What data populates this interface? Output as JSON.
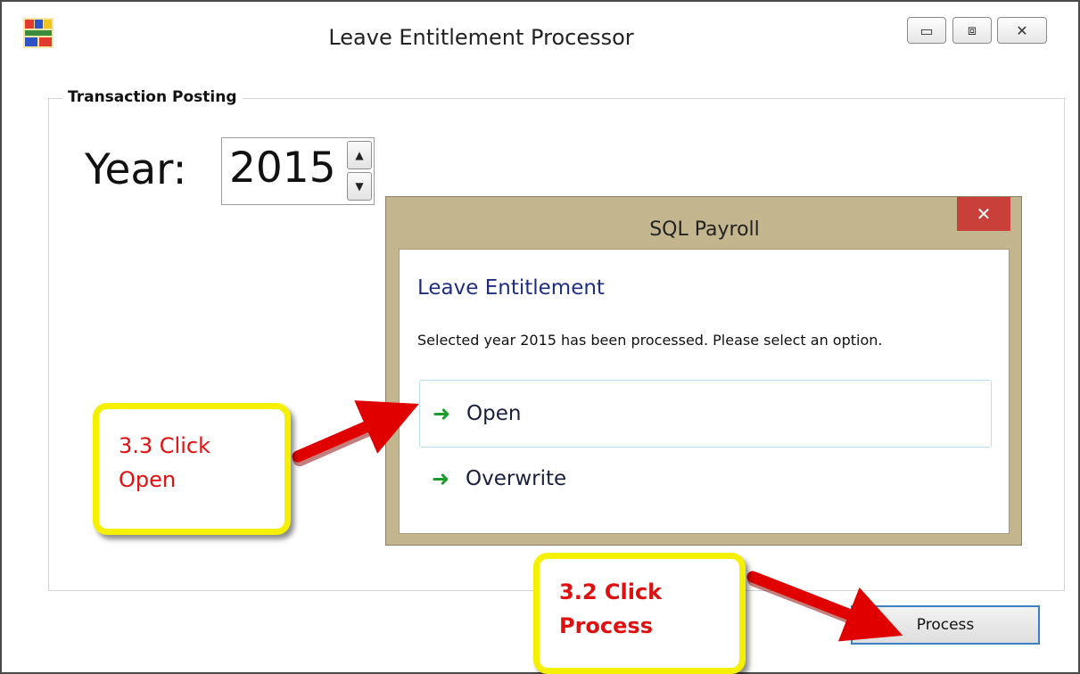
{
  "window": {
    "title": "Leave Entitlement Processor",
    "app_icon": "app-icon",
    "controls": {
      "minimize": "▭",
      "maximize": "⧈",
      "close": "✕"
    }
  },
  "group": {
    "label": "Transaction Posting",
    "year_label": "Year:",
    "year_value": "2015"
  },
  "process_button": "Process",
  "dialog": {
    "title": "SQL Payroll",
    "close": "✕",
    "heading": "Leave Entitlement",
    "message": "Selected year 2015 has been processed. Please select an option.",
    "options": [
      {
        "label": "Open",
        "icon": "green-arrow-icon"
      },
      {
        "label": "Overwrite",
        "icon": "green-arrow-icon"
      }
    ]
  },
  "callouts": {
    "open": [
      "3.3 Click",
      "Open"
    ],
    "process": [
      "3.2 Click",
      "Process"
    ]
  },
  "colors": {
    "dialog_frame": "#c3b68e",
    "dialog_close": "#c9403a",
    "heading_blue": "#1f2e80",
    "callout_border": "#f4f000",
    "callout_text": "#e01010",
    "arrow_red": "#e00000",
    "option_arrow": "#1c9c2a"
  }
}
